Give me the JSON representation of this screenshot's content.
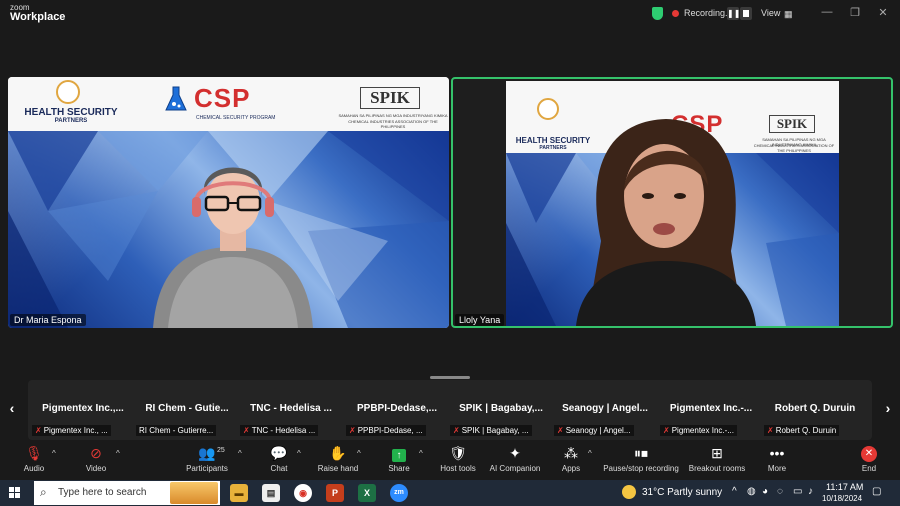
{
  "app": {
    "brand_top": "zoom",
    "brand_bottom": "Workplace",
    "recording_label": "Recording...",
    "view_label": "View"
  },
  "tiles": [
    {
      "name": "Dr Maria Espona",
      "banner": {
        "left_org": "HEALTH SECURITY",
        "left_org2": "PARTNERS",
        "center_org": "CSP",
        "center_sub": "CHEMICAL SECURITY PROGRAM",
        "right_org": "SPIK",
        "right_sub1": "SAMAHAN SA PILIPINAS NG MGA INDUSTRIYANG KIMIKA",
        "right_sub2": "CHEMICAL INDUSTRIES ASSOCIATION OF THE PHILIPPINES"
      }
    },
    {
      "name": "Lloly Yana",
      "banner": {
        "left_org": "HEALTH SECURITY",
        "left_org2": "PARTNERS",
        "center_org": "CSP",
        "right_org": "SPIK",
        "right_sub1": "SAMAHAN SA PILIPINAS NG MGA INDUSTRIYANG KIMIKA",
        "right_sub2": "CHEMICAL INDUSTRIES ASSOCIATION OF THE PHILIPPINES"
      }
    }
  ],
  "participants": [
    {
      "name": "Pigmentex  Inc.,...",
      "label": "Pigmentex Inc., ..."
    },
    {
      "name": "RI Chem - Gutie...",
      "label": "RI Chem - Gutierre..."
    },
    {
      "name": "TNC - Hedelisa ...",
      "label": "TNC - Hedelisa ..."
    },
    {
      "name": "PPBPI-Dedase,...",
      "label": "PPBPI-Dedase, ..."
    },
    {
      "name": "SPIK | Bagabay,...",
      "label": "SPIK | Bagabay, ..."
    },
    {
      "name": "Seanogy | Angel...",
      "label": "Seanogy | Angel..."
    },
    {
      "name": "Pigmentex  Inc.-...",
      "label": "Pigmentex Inc.-..."
    },
    {
      "name": "Robert Q. Duruin",
      "label": "Robert Q. Duruin"
    }
  ],
  "toolbar": {
    "audio": "Audio",
    "video": "Video",
    "participants": "Participants",
    "participants_count": "25",
    "chat": "Chat",
    "raise_hand": "Raise hand",
    "share": "Share",
    "host_tools": "Host tools",
    "ai_companion": "AI Companion",
    "apps": "Apps",
    "pause_stop": "Pause/stop recording",
    "breakout": "Breakout rooms",
    "more": "More",
    "end": "End"
  },
  "taskbar": {
    "search_placeholder": "Type here to search",
    "weather": "31°C  Partly sunny",
    "time": "11:17 AM",
    "date": "10/18/2024",
    "apps": [
      "file-explorer",
      "notes",
      "chrome",
      "powerpoint",
      "excel",
      "zoom"
    ]
  },
  "colors": {
    "active_speaker_border": "#35c26b",
    "recording_dot": "#e53935",
    "end_button": "#e53935",
    "shield": "#2ecc71"
  }
}
